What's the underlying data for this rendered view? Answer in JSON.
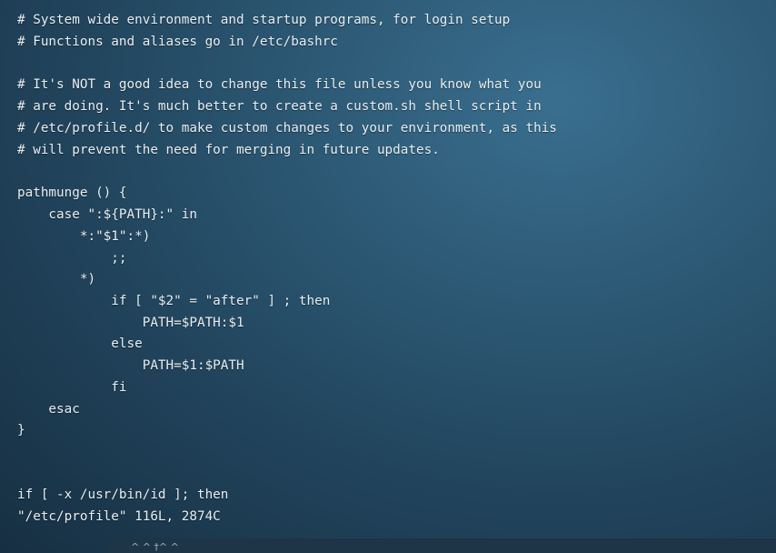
{
  "terminal": {
    "lines": [
      "# System wide environment and startup programs, for login setup",
      "# Functions and aliases go in /etc/bashrc",
      "",
      "# It's NOT a good idea to change this file unless you know what you",
      "# are doing. It's much better to create a custom.sh shell script in",
      "# /etc/profile.d/ to make custom changes to your environment, as this",
      "# will prevent the need for merging in future updates.",
      "",
      "pathmunge () {",
      "    case \":${PATH}:\" in",
      "        *:\"$1\":*)",
      "            ;;",
      "        *)",
      "            if [ \"$2\" = \"after\" ] ; then",
      "                PATH=$PATH:$1",
      "            else",
      "                PATH=$1:$PATH",
      "            fi",
      "    esac",
      "}",
      "",
      "",
      "if [ -x /usr/bin/id ]; then"
    ],
    "status_line": "\"/etc/profile\" 116L, 2874C"
  },
  "taskbar": {
    "label": "^ ^ †^ ^"
  },
  "colors": {
    "text": "#e8eef2",
    "background": "#2d5a76",
    "taskbar": "#1e3447"
  }
}
